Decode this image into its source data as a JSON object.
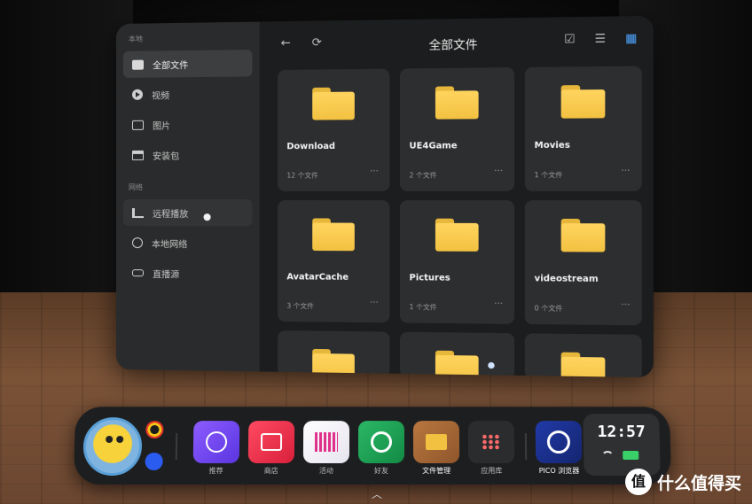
{
  "sidebar": {
    "section_local": "本地",
    "section_network": "网络",
    "items": [
      {
        "label": "全部文件",
        "icon": "folder-icon"
      },
      {
        "label": "视频",
        "icon": "video-icon"
      },
      {
        "label": "图片",
        "icon": "image-icon"
      },
      {
        "label": "安装包",
        "icon": "package-icon"
      },
      {
        "label": "远程播放",
        "icon": "remote-play-icon"
      },
      {
        "label": "本地网络",
        "icon": "globe-icon"
      },
      {
        "label": "直播源",
        "icon": "dlna-icon"
      }
    ]
  },
  "header": {
    "title": "全部文件",
    "back_icon": "←",
    "refresh_icon": "⟳",
    "select_icon": "☑",
    "sort_icon": "☰",
    "view_icon": "▦"
  },
  "folders": [
    {
      "name": "Download",
      "count": "12 个文件"
    },
    {
      "name": "UE4Game",
      "count": "2 个文件"
    },
    {
      "name": "Movies",
      "count": "1 个文件"
    },
    {
      "name": "AvatarCache",
      "count": "3 个文件"
    },
    {
      "name": "Pictures",
      "count": "1 个文件"
    },
    {
      "name": "videostream",
      "count": "0 个文件"
    }
  ],
  "more_glyph": "···",
  "dock": {
    "apps": [
      {
        "label": "推荐",
        "color": "#7b4df0"
      },
      {
        "label": "商店",
        "color": "#f2364e"
      },
      {
        "label": "活动",
        "color": "#f0eef4"
      },
      {
        "label": "好友",
        "color": "#1fa05a"
      },
      {
        "label": "文件管理",
        "color": "#a7683b"
      },
      {
        "label": "应用库",
        "color": "#2b2c2e"
      },
      {
        "label": "PICO 浏览器",
        "color": "#1b2c8a"
      }
    ],
    "clock": "12:57"
  },
  "chevron": "︿",
  "watermark": {
    "logo": "值",
    "text": "什么值得买"
  }
}
